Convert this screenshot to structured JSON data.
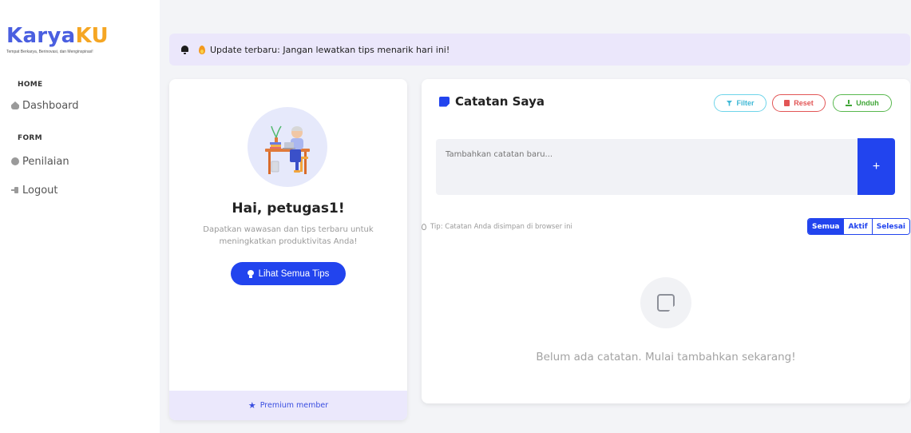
{
  "brand": {
    "name_part1": "Karya",
    "name_part2": "KU",
    "tagline": "Tempat Berkarya, Berinovasi, dan Menginspirasi!"
  },
  "sidebar": {
    "sections": [
      {
        "heading": "HOME",
        "items": [
          {
            "label": "Dashboard",
            "icon": "home-icon"
          }
        ]
      },
      {
        "heading": "FORM",
        "items": [
          {
            "label": "Penilaian",
            "icon": "circle-icon"
          }
        ]
      }
    ],
    "logout_label": "Logout"
  },
  "banner": {
    "text": "Update terbaru: Jangan lewatkan tips menarik hari ini!"
  },
  "profile": {
    "greeting": "Hai, petugas1!",
    "subtitle": "Dapatkan wawasan dan tips terbaru untuk meningkatkan produktivitas Anda!",
    "tips_button": "Lihat Semua Tips",
    "premium_label": "Premium member"
  },
  "notes": {
    "title": "Catatan Saya",
    "filter_label": "Filter",
    "reset_label": "Reset",
    "download_label": "Unduh",
    "input_placeholder": "Tambahkan catatan baru...",
    "add_button": "+",
    "tip": "Tip: Catatan Anda disimpan di browser ini",
    "segments": [
      "Semua",
      "Aktif",
      "Selesai"
    ],
    "active_segment": "Semua",
    "empty_message": "Belum ada catatan. Mulai tambahkan sekarang!"
  },
  "colors": {
    "primary": "#2244ee",
    "brand_blue": "#4a5fe0",
    "brand_orange": "#f5a623",
    "banner_bg": "#ebe7fb"
  }
}
